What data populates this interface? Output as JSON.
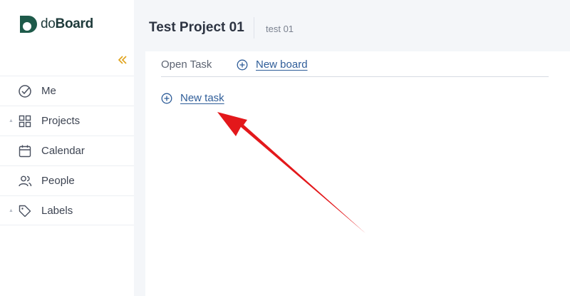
{
  "logo": {
    "text_light": "do",
    "text_bold": "Board",
    "brand_color": "#1e5a4a"
  },
  "sidebar": {
    "collapse_icon": "double-chevron-left-icon",
    "items": [
      {
        "label": "Me",
        "icon": "check-circle-icon",
        "has_caret": false
      },
      {
        "label": "Projects",
        "icon": "grid-icon",
        "has_caret": true
      },
      {
        "label": "Calendar",
        "icon": "calendar-icon",
        "has_caret": false
      },
      {
        "label": "People",
        "icon": "people-icon",
        "has_caret": false
      },
      {
        "label": "Labels",
        "icon": "tag-icon",
        "has_caret": true
      }
    ]
  },
  "header": {
    "title": "Test Project 01",
    "subtitle": "test 01"
  },
  "tabs": {
    "open_task": "Open Task",
    "new_board": "New board"
  },
  "board": {
    "new_task": "New task"
  },
  "colors": {
    "accent": "#e0a21a",
    "link": "#2f5d99",
    "annotation_arrow": "#e3181b"
  }
}
